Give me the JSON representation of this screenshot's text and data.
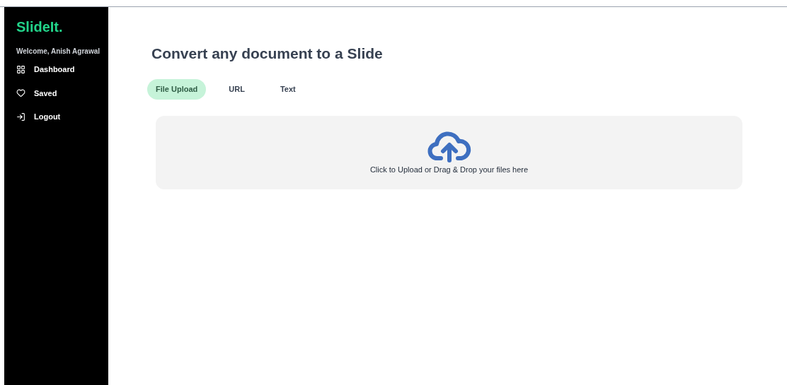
{
  "sidebar": {
    "logo": "SlideIt.",
    "welcome": "Welcome, Anish Agrawal",
    "items": [
      {
        "label": "Dashboard",
        "kind": "grid"
      },
      {
        "label": "Saved",
        "kind": "heart"
      },
      {
        "label": "Logout",
        "kind": "logout"
      }
    ]
  },
  "main": {
    "title": "Convert any document to a Slide",
    "tabs": [
      {
        "label": "File Upload",
        "selected": true
      },
      {
        "label": "URL",
        "selected": false
      },
      {
        "label": "Text",
        "selected": false
      }
    ],
    "dropzone": {
      "text": "Click to Upload or Drag & Drop your files here"
    }
  }
}
